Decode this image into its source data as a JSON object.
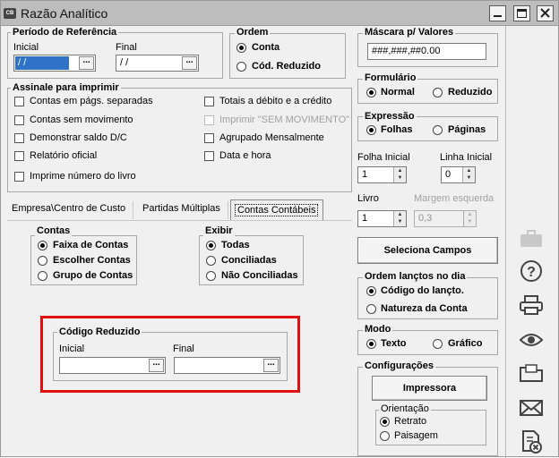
{
  "window": {
    "title": "Razão Analítico",
    "icon_text": "CB"
  },
  "periodo": {
    "title": "Período de Referência",
    "inicial_label": "Inicial",
    "inicial_value": "/ /",
    "final_label": "Final",
    "final_value": "/ /",
    "ellipsis": "..."
  },
  "ordem": {
    "title": "Ordem",
    "options": [
      "Conta",
      "Cód. Reduzido"
    ]
  },
  "mascara": {
    "title": "Máscara p/ Valores",
    "value": "###,###,##0.00"
  },
  "formulario": {
    "title": "Formulário",
    "options": [
      "Normal",
      "Reduzido"
    ]
  },
  "expressao": {
    "title": "Expressão",
    "options": [
      "Folhas",
      "Páginas"
    ]
  },
  "folha_inicial": {
    "label": "Folha Inicial",
    "value": "1"
  },
  "linha_inicial": {
    "label": "Linha Inicial",
    "value": "0"
  },
  "livro": {
    "label": "Livro",
    "value": "1"
  },
  "margem": {
    "label": "Margem esquerda",
    "value": "0,3"
  },
  "assinale": {
    "title": "Assinale para imprimir",
    "left": [
      "Contas em págs. separadas",
      "Contas sem movimento",
      "Demonstrar saldo D/C",
      "Relatório oficial",
      "Imprime número do livro"
    ],
    "right": [
      "Totais a débito e a crédito",
      "Imprimir \"SEM MOVIMENTO\"",
      "Agrupado Mensalmente",
      "Data e hora"
    ]
  },
  "tabs": [
    "Empresa\\Centro de Custo",
    "Partidas Múltiplas",
    "Contas Contábeis"
  ],
  "contas": {
    "title": "Contas",
    "options": [
      "Faixa de Contas",
      "Escolher Contas",
      "Grupo de Contas"
    ]
  },
  "exibir": {
    "title": "Exibir",
    "options": [
      "Todas",
      "Conciliadas",
      "Não Conciliadas"
    ]
  },
  "codigo": {
    "title": "Código Reduzido",
    "inicial_label": "Inicial",
    "final_label": "Final"
  },
  "seleciona_btn": "Seleciona Campos",
  "ordem_lanc": {
    "title": "Ordem lançtos no dia",
    "options": [
      "Código do lançto.",
      "Natureza da Conta"
    ]
  },
  "modo": {
    "title": "Modo",
    "options": [
      "Texto",
      "Gráfico"
    ]
  },
  "config": {
    "title": "Configurações",
    "button": "Impressora",
    "orientacao_title": "Orientação",
    "options": [
      "Retrato",
      "Paisagem"
    ]
  },
  "colors": {
    "titlebar": "#bdbdbd",
    "highlight": "#e01010",
    "selection": "#3072c8"
  },
  "side_icons": [
    "briefcase-icon",
    "help-icon",
    "printer-icon",
    "preview-eye-icon",
    "folder-icon",
    "mail-icon",
    "close-document-icon"
  ]
}
